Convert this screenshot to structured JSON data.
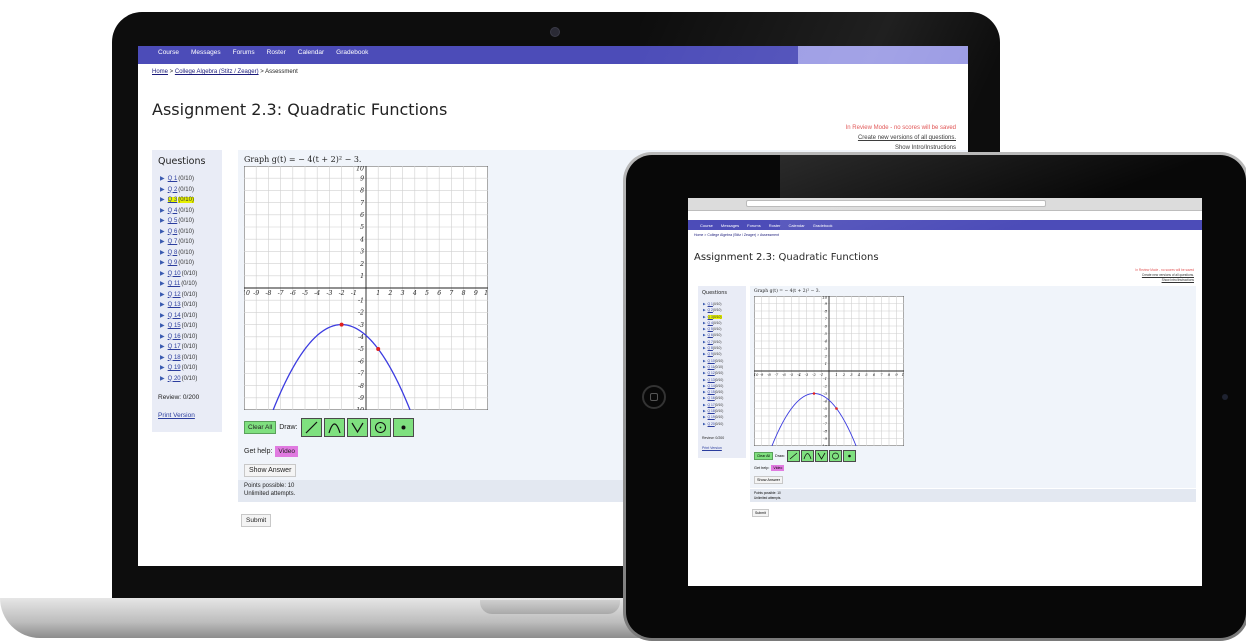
{
  "nav": {
    "items": [
      "Course",
      "Messages",
      "Forums",
      "Roster",
      "Calendar",
      "Gradebook"
    ]
  },
  "breadcrumb": {
    "home": "Home",
    "sep1": " > ",
    "course": "College Algebra (Stitz / Zeager)",
    "sep2": " > ",
    "current": "Assessment"
  },
  "tablet_breadcrumb": "Home > College Algebra (Stitz / Zeager) > Assessment",
  "page_title": "Assignment 2.3: Quadratic Functions",
  "review_notice": {
    "mode": "In Review Mode - no scores will be saved",
    "new_versions": "Create new versions of all questions.",
    "show_intro": "Show Intro/Instructions"
  },
  "questions_panel": {
    "heading": "Questions",
    "items": [
      {
        "label": "Q 1",
        "score": "(0/10)"
      },
      {
        "label": "Q 2",
        "score": "(0/10)"
      },
      {
        "label": "Q 3",
        "score": "(0/10)"
      },
      {
        "label": "Q 4",
        "score": "(0/10)"
      },
      {
        "label": "Q 5",
        "score": "(0/10)"
      },
      {
        "label": "Q 6",
        "score": "(0/10)"
      },
      {
        "label": "Q 7",
        "score": "(0/10)"
      },
      {
        "label": "Q 8",
        "score": "(0/10)"
      },
      {
        "label": "Q 9",
        "score": "(0/10)"
      },
      {
        "label": "Q 10",
        "score": "(0/10)"
      },
      {
        "label": "Q 11",
        "score": "(0/10)"
      },
      {
        "label": "Q 12",
        "score": "(0/10)"
      },
      {
        "label": "Q 13",
        "score": "(0/10)"
      },
      {
        "label": "Q 14",
        "score": "(0/10)"
      },
      {
        "label": "Q 15",
        "score": "(0/10)"
      },
      {
        "label": "Q 16",
        "score": "(0/10)"
      },
      {
        "label": "Q 17",
        "score": "(0/10)"
      },
      {
        "label": "Q 18",
        "score": "(0/10)"
      },
      {
        "label": "Q 19",
        "score": "(0/10)"
      },
      {
        "label": "Q 20",
        "score": "(0/10)"
      }
    ],
    "current_index": 2,
    "review": "Review: 0/200",
    "print_version": "Print Version"
  },
  "question": {
    "prompt": "Graph g(t) = − 4(t + 2)² − 3.",
    "graph": {
      "x_range": [
        -10,
        10
      ],
      "y_range": [
        -10,
        10
      ],
      "x_tick_labels": [
        "10",
        "-9",
        "-8",
        "-7",
        "-6",
        "-5",
        "-4",
        "-3",
        "-2",
        "-1",
        "1",
        "2",
        "3",
        "4",
        "5",
        "6",
        "7",
        "8",
        "9",
        "10"
      ],
      "y_tick_labels": [
        "10",
        "9",
        "8",
        "7",
        "6",
        "5",
        "4",
        "3",
        "2",
        "1",
        "-1",
        "-2",
        "-3",
        "-4",
        "-5",
        "-6",
        "-7",
        "-8",
        "-9",
        "-10"
      ],
      "plotted_points": [
        [
          -2,
          -3
        ],
        [
          1,
          -5
        ]
      ],
      "curve_color": "#3c3ce0",
      "point_color": "#e02020"
    },
    "clear_all": "Clear All",
    "draw_label": "Draw:",
    "draw_tools": [
      "line-icon",
      "parabola-down-icon",
      "parabola-up-icon",
      "circle-icon",
      "dot-icon"
    ],
    "help_label": "Get help:",
    "video_button": "Video",
    "show_answer": "Show Answer",
    "points_possible": "Points possible: 10",
    "attempts": "Unlimited attempts.",
    "submit": "Submit"
  },
  "colors": {
    "nav": "#4c4cb8",
    "tool_green": "#7fe07f",
    "video_pink": "#e07ae0",
    "current_highlight": "#e6f100",
    "review_red": "#e05050"
  }
}
